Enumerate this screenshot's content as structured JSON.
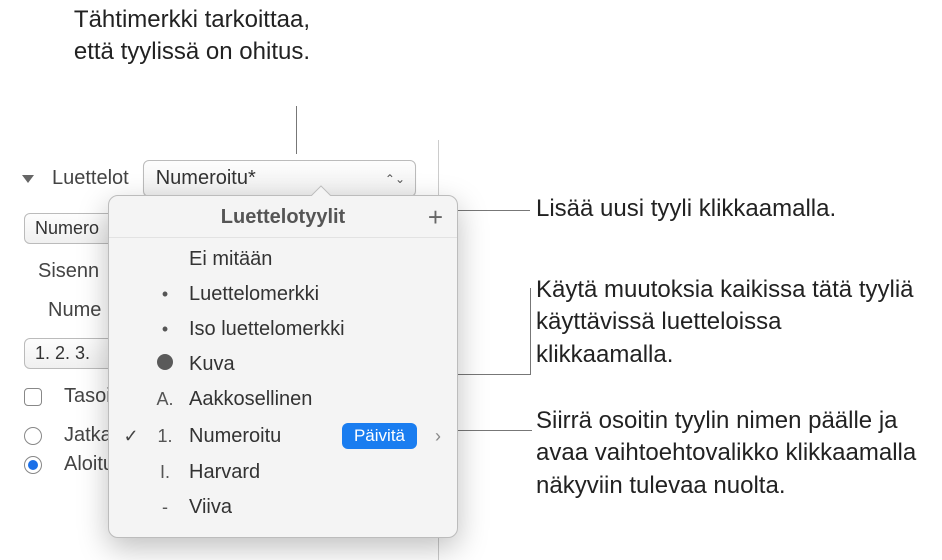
{
  "callouts": {
    "top": "Tähtimerkki tarkoittaa, että tyylissä on ohitus.",
    "add": "Lisää uusi tyyli klikkaamalla.",
    "update": "Käytä muutoksia kaikissa tätä tyyliä käyttävissä luetteloissa klikkaamalla.",
    "arrow": "Siirrä osoitin tyylin nimen päälle ja avaa vaihtoehtovalikko klikkaamalla näkyviin tulevaa nuolta."
  },
  "panel": {
    "lists_label": "Luettelot",
    "current_style": "Numeroitu*",
    "numero_trunc": "Numero",
    "sisenn_trunc": "Sisenn",
    "nume_trunc": "Nume",
    "number_format": "1. 2. 3.",
    "tasoit_label": "Tasoit",
    "continue_label": "Jatka",
    "start_label": "Aloitus"
  },
  "popover": {
    "title": "Luettelotyylit",
    "update_label": "Päivitä",
    "items": [
      {
        "bullet": "",
        "name": "Ei mitään"
      },
      {
        "bullet": "•",
        "name": "Luettelomerkki"
      },
      {
        "bullet": "•",
        "name": "Iso luettelomerkki"
      },
      {
        "bullet": "img",
        "name": "Kuva"
      },
      {
        "bullet": "A.",
        "name": "Aakkosellinen"
      },
      {
        "bullet": "1.",
        "name": "Numeroitu",
        "selected": true,
        "showUpdate": true
      },
      {
        "bullet": "I.",
        "name": "Harvard"
      },
      {
        "bullet": "-",
        "name": "Viiva"
      }
    ]
  }
}
